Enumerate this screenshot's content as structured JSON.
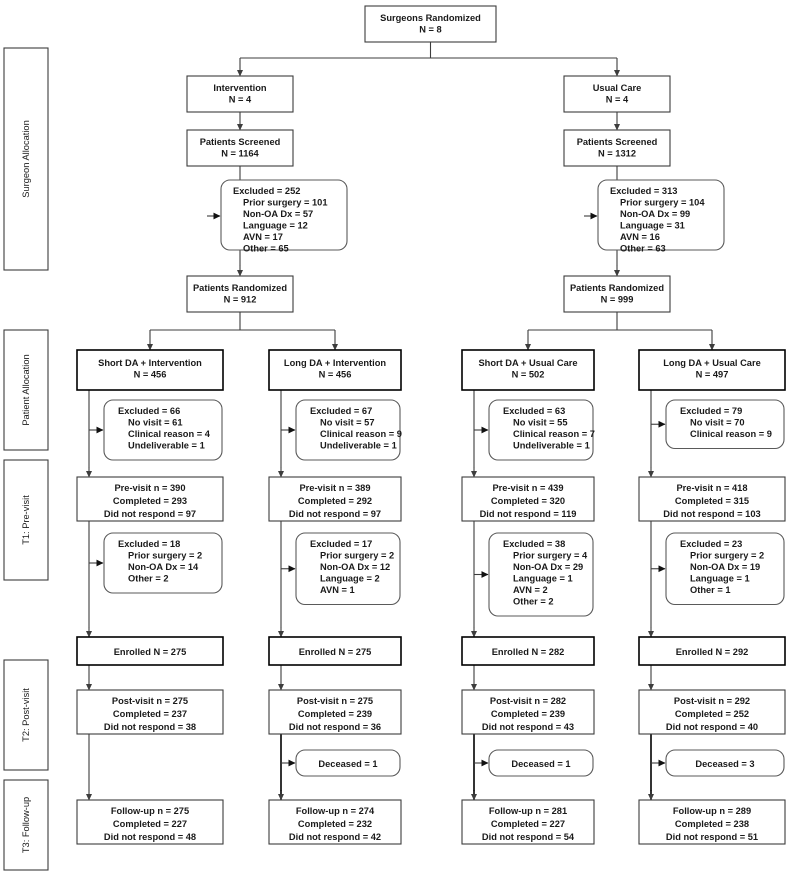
{
  "figure": {
    "type": "consort-flow-diagram",
    "title": "Surgeons Randomized trial flow"
  },
  "stages": [
    {
      "id": "surgeon-allocation",
      "label": "Surgeon Allocation"
    },
    {
      "id": "patient-allocation",
      "label": "Patient Allocation"
    },
    {
      "id": "t1-pre-visit",
      "label": "T1: Pre-visit"
    },
    {
      "id": "t2-post-visit",
      "label": "T2: Post-visit"
    },
    {
      "id": "t3-follow-up",
      "label": "T3: Follow-up"
    }
  ],
  "root": {
    "line1": "Surgeons Randomized",
    "line2": "N = 8"
  },
  "arms": [
    {
      "id": "intervention",
      "allocation": {
        "line1": "Intervention",
        "line2": "N = 4"
      },
      "screened": {
        "line1": "Patients Screened",
        "line2": "N = 1164"
      },
      "screen_excluded": [
        "Excluded = 252",
        "Prior surgery = 101",
        "Non-OA Dx = 57",
        "Language = 12",
        "AVN = 17",
        "Other = 65"
      ],
      "randomized": {
        "line1": "Patients Randomized",
        "line2": "N = 912"
      }
    },
    {
      "id": "usual-care",
      "allocation": {
        "line1": "Usual Care",
        "line2": "N = 4"
      },
      "screened": {
        "line1": "Patients Screened",
        "line2": "N = 1312"
      },
      "screen_excluded": [
        "Excluded = 313",
        "Prior surgery = 104",
        "Non-OA Dx = 99",
        "Language = 31",
        "AVN = 16",
        "Other = 63"
      ],
      "randomized": {
        "line1": "Patients Randomized",
        "line2": "N = 999"
      }
    }
  ],
  "groups": [
    {
      "id": "short-da-intervention",
      "header": {
        "line1": "Short DA + Intervention",
        "line2": "N = 456"
      },
      "excluded_pre": [
        "Excluded = 66",
        "No visit = 61",
        "Clinical reason = 4",
        "Undeliverable = 1"
      ],
      "previsit": {
        "n": "Pre-visit n = 390",
        "completed": "Completed = 293",
        "no_response": "Did not respond = 97"
      },
      "excluded_enroll": [
        "Excluded = 18",
        "Prior surgery = 2",
        "Non-OA Dx = 14",
        "Other = 2"
      ],
      "enrolled": "Enrolled N = 275",
      "postvisit": {
        "n": "Post-visit n = 275",
        "completed": "Completed = 237",
        "no_response": "Did not respond = 38"
      },
      "deceased": null,
      "followup": {
        "n": "Follow-up n = 275",
        "completed": "Completed = 227",
        "no_response": "Did not respond = 48"
      }
    },
    {
      "id": "long-da-intervention",
      "header": {
        "line1": "Long DA + Intervention",
        "line2": "N = 456"
      },
      "excluded_pre": [
        "Excluded = 67",
        "No visit = 57",
        "Clinical reason = 9",
        "Undeliverable = 1"
      ],
      "previsit": {
        "n": "Pre-visit n = 389",
        "completed": "Completed = 292",
        "no_response": "Did not respond = 97"
      },
      "excluded_enroll": [
        "Excluded = 17",
        "Prior surgery = 2",
        "Non-OA Dx = 12",
        "Language = 2",
        "AVN = 1"
      ],
      "enrolled": "Enrolled N = 275",
      "postvisit": {
        "n": "Post-visit n = 275",
        "completed": "Completed = 239",
        "no_response": "Did not respond = 36"
      },
      "deceased": "Deceased = 1",
      "followup": {
        "n": "Follow-up n = 274",
        "completed": "Completed = 232",
        "no_response": "Did not respond = 42"
      }
    },
    {
      "id": "short-da-usual-care",
      "header": {
        "line1": "Short DA + Usual Care",
        "line2": "N = 502"
      },
      "excluded_pre": [
        "Excluded = 63",
        "No visit = 55",
        "Clinical reason = 7",
        "Undeliverable = 1"
      ],
      "previsit": {
        "n": "Pre-visit n = 439",
        "completed": "Completed = 320",
        "no_response": "Did not respond = 119"
      },
      "excluded_enroll": [
        "Excluded = 38",
        "Prior surgery = 4",
        "Non-OA Dx = 29",
        "Language = 1",
        "AVN = 2",
        "Other = 2"
      ],
      "enrolled": "Enrolled N = 282",
      "postvisit": {
        "n": "Post-visit n = 282",
        "completed": "Completed = 239",
        "no_response": "Did not respond = 43"
      },
      "deceased": "Deceased = 1",
      "followup": {
        "n": "Follow-up n = 281",
        "completed": "Completed = 227",
        "no_response": "Did not respond = 54"
      }
    },
    {
      "id": "long-da-usual-care",
      "header": {
        "line1": "Long DA + Usual Care",
        "line2": "N = 497"
      },
      "excluded_pre": [
        "Excluded = 79",
        "No visit = 70",
        "Clinical reason = 9"
      ],
      "previsit": {
        "n": "Pre-visit n = 418",
        "completed": "Completed = 315",
        "no_response": "Did not respond = 103"
      },
      "excluded_enroll": [
        "Excluded = 23",
        "Prior surgery = 2",
        "Non-OA Dx = 19",
        "Language = 1",
        "Other = 1"
      ],
      "enrolled": "Enrolled N = 292",
      "postvisit": {
        "n": "Post-visit n = 292",
        "completed": "Completed = 252",
        "no_response": "Did not respond = 40"
      },
      "deceased": "Deceased = 3",
      "followup": {
        "n": "Follow-up n = 289",
        "completed": "Completed = 238",
        "no_response": "Did not respond = 51"
      }
    }
  ],
  "colors": {
    "stroke": "#3d3d3d",
    "text": "#1a1a1a",
    "background": "#ffffff"
  }
}
